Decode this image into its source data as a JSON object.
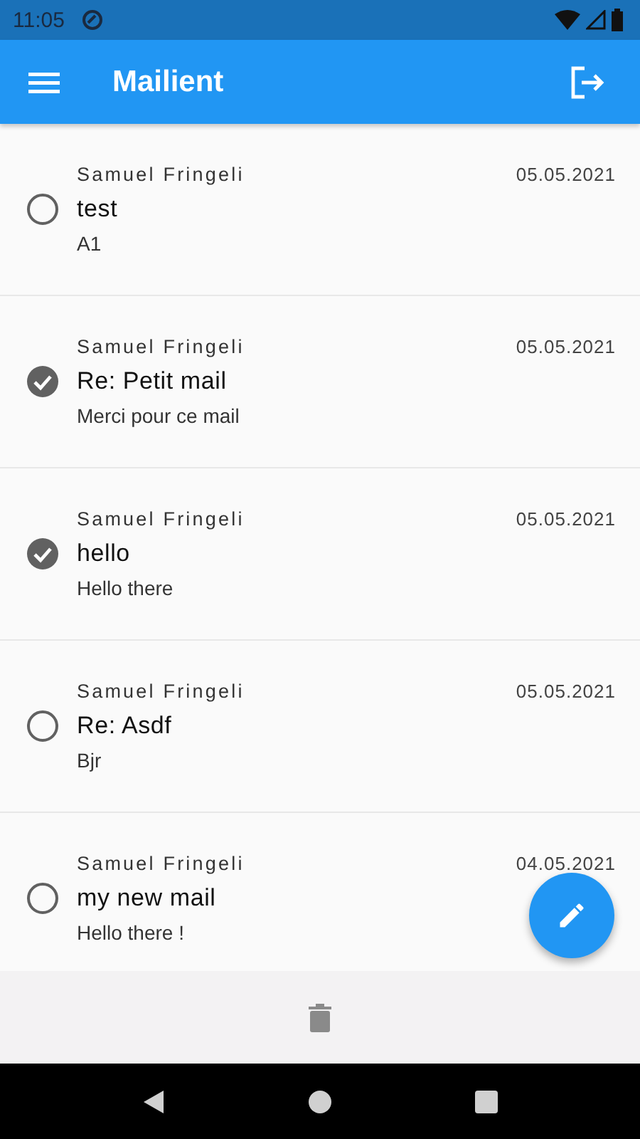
{
  "status_bar": {
    "time": "11:05"
  },
  "app_bar": {
    "title": "Mailient"
  },
  "mails": [
    {
      "sender": "Samuel Fringeli",
      "date": "05.05.2021",
      "subject": "test",
      "preview": "A1",
      "selected": false
    },
    {
      "sender": "Samuel Fringeli",
      "date": "05.05.2021",
      "subject": "Re: Petit mail",
      "preview": "Merci pour ce mail",
      "selected": true
    },
    {
      "sender": "Samuel Fringeli",
      "date": "05.05.2021",
      "subject": "hello",
      "preview": "Hello there",
      "selected": true
    },
    {
      "sender": "Samuel Fringeli",
      "date": "05.05.2021",
      "subject": "Re: Asdf",
      "preview": "Bjr",
      "selected": false
    },
    {
      "sender": "Samuel Fringeli",
      "date": "04.05.2021",
      "subject": "my new mail",
      "preview": "Hello there !",
      "selected": false
    }
  ]
}
